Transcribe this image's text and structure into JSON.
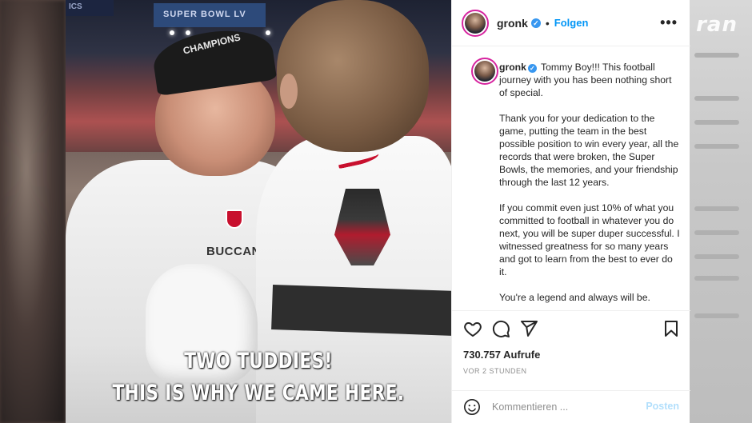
{
  "watermark": "ran",
  "video": {
    "banner_left": "ICS",
    "banner": "SUPER BOWL LV",
    "cap_text": "CHAMPIONS",
    "jersey_text": "BUCCANEE",
    "subtitle_line1": "TWO TUDDIES!",
    "subtitle_line2": "THIS IS WHY WE CAME HERE."
  },
  "post": {
    "username": "gronk",
    "follow_label": "Folgen",
    "more_label": "•••",
    "caption_lead": "Tommy Boy!!! This football journey with you has been nothing short of special.",
    "paragraphs": [
      "Thank you for your dedication to the game, putting the team in the best possible position to win every year, all the records that were broken, the Super Bowls, the memories, and your friendship through the last 12 years.",
      "If you commit even just 10% of what you committed to football in whatever you do next, you will be super duper successful. I witnessed greatness for so many years and got to learn from the best to ever do it.",
      "You're a legend and always will be."
    ],
    "views": "730.757 Aufrufe",
    "time": "VOR 2 STUNDEN",
    "comment_placeholder": "Kommentieren ...",
    "post_button": "Posten",
    "icons": [
      "heart-icon",
      "comment-icon",
      "share-icon",
      "bookmark-icon",
      "emoji-icon",
      "verified-icon"
    ]
  }
}
